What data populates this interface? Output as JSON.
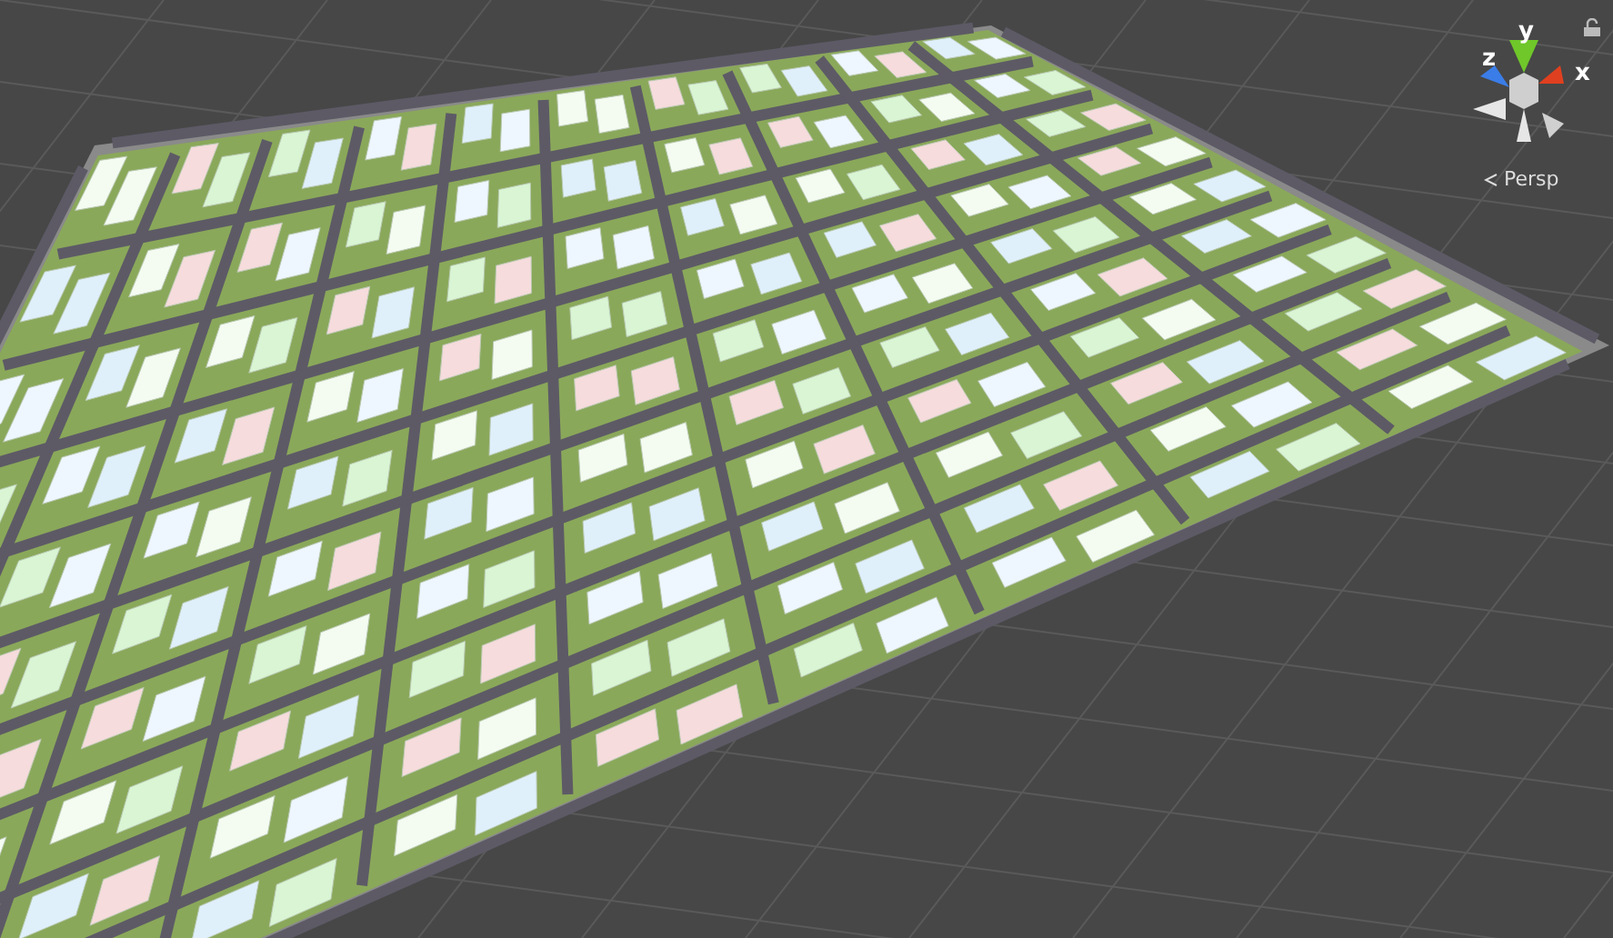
{
  "scene_view": {
    "gizmo": {
      "axes": [
        {
          "label": "y",
          "color": "#6fc72a"
        },
        {
          "label": "z",
          "color": "#3b7de8"
        },
        {
          "label": "x",
          "color": "#e0401f"
        }
      ],
      "projection": "Persp"
    }
  }
}
